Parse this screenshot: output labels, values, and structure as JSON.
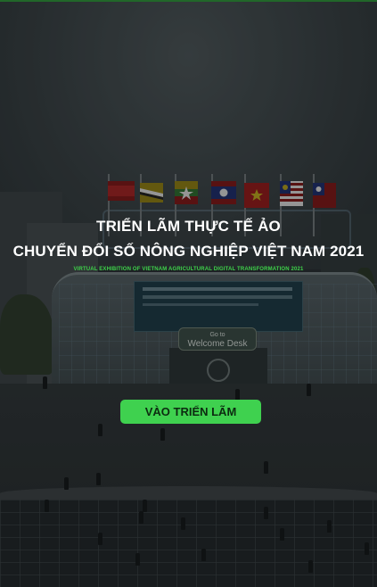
{
  "header": {
    "title_line1": "TRIỂN LÃM THỰC TẾ ẢO",
    "title_line2": "CHUYỂN ĐỔI SỐ NÔNG NGHIỆP VIỆT NAM 2021",
    "subtitle": "VIRTUAL EXHIBITION OF VIETNAM AGRICULTURAL DIGITAL TRANSFORMATION 2021"
  },
  "scene": {
    "welcome_sign_line1": "Go to",
    "welcome_sign_line2": "Welcome Desk",
    "flags": [
      "cambodia-flag",
      "brunei-flag",
      "myanmar-flag",
      "laos-flag",
      "vietnam-flag",
      "malaysia-flag",
      "thailand-flag"
    ]
  },
  "actions": {
    "enter_label": "VÀO TRIỂN LÃM"
  },
  "colors": {
    "accent": "#3fd14f",
    "subtitle": "#3ed24a",
    "top_line": "#2f8f3a"
  }
}
